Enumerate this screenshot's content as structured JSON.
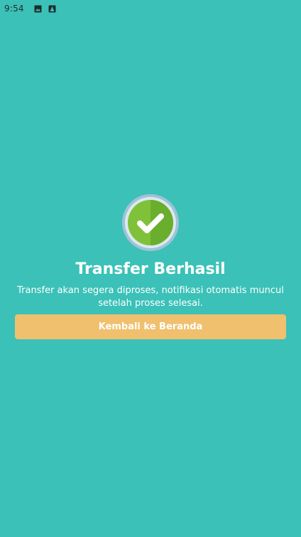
{
  "status_bar": {
    "time": "9:54",
    "icons": [
      "image-icon",
      "app-notification-icon"
    ]
  },
  "success": {
    "icon": "check-circle-icon",
    "title": "Transfer Berhasil",
    "message": "Transfer akan segera diproses, notifikasi otomatis muncul setelah proses selesai."
  },
  "actions": {
    "home_label": "Kembali ke Beranda"
  },
  "colors": {
    "background": "#3bc1b7",
    "button": "#f0c06e",
    "check_green": "#7fc23a",
    "text": "#ffffff"
  }
}
